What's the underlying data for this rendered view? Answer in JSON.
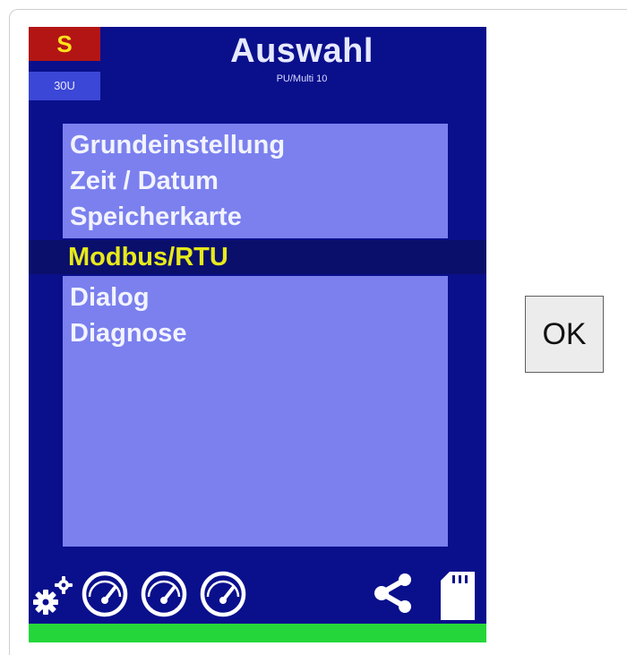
{
  "header": {
    "mode_badge": "S",
    "mode_sub": "30U",
    "title": "Auswahl",
    "subtitle": "PU/Multi 10"
  },
  "menu": {
    "items": [
      "Grundeinstellung",
      "Zeit / Datum",
      "Speicherkarte",
      "Modbus/RTU",
      "Dialog",
      "Diagnose"
    ],
    "selected_index": 3
  },
  "footer": {
    "icons": [
      "settings-gears-icon",
      "gauge-icon",
      "gauge-icon",
      "gauge-icon",
      "share-icon",
      "sd-card-icon"
    ]
  },
  "ok_button": {
    "label": "OK"
  },
  "colors": {
    "screen_bg": "#0a0f8c",
    "menu_bg": "#7b80ee",
    "selected_text": "#e7ea1a",
    "badge_red": "#b31515",
    "status_green": "#25d63a"
  }
}
